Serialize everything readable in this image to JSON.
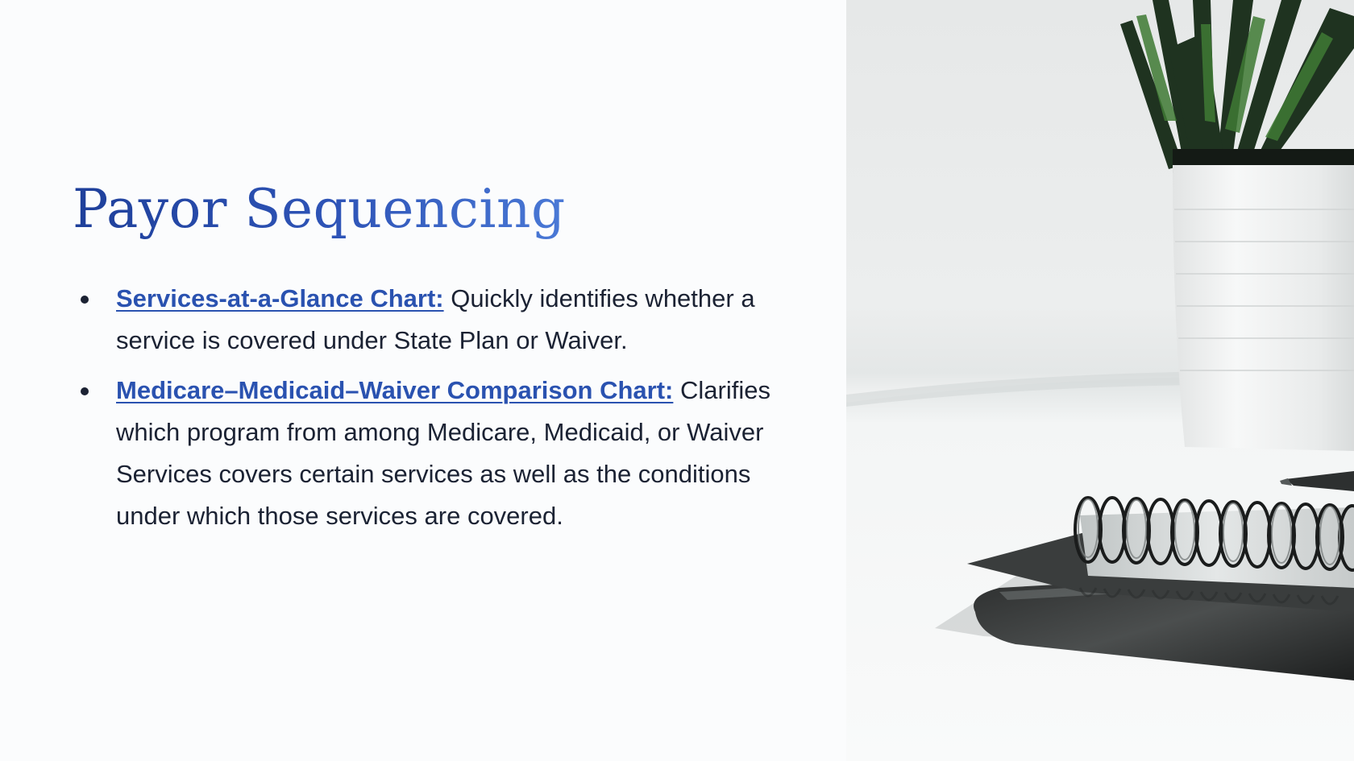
{
  "slide": {
    "title": "Payor Sequencing",
    "bullets": [
      {
        "link_text": "Services-at-a-Glance Chart:",
        "text": " Quickly identifies whether a service is covered under State Plan or Waiver."
      },
      {
        "link_text": "Medicare–Medicaid–Waiver Comparison Chart:",
        "text": " Clarifies which program from among Medicare, Medicaid, or Waiver Services covers certain services as well as the conditions under which those services are covered."
      }
    ]
  },
  "photo": {
    "icon": "desk-plant-notebook-photo"
  },
  "colors": {
    "title_gradient_start": "#1e3f9a",
    "title_gradient_end": "#4a79d6",
    "link": "#2a52b0",
    "body_text": "#1b2233",
    "background": "#fbfcfd"
  }
}
